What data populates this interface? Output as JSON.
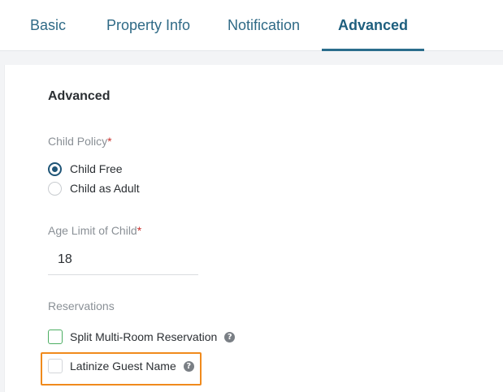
{
  "tabs": [
    {
      "label": "Basic"
    },
    {
      "label": "Property Info"
    },
    {
      "label": "Notification"
    },
    {
      "label": "Advanced",
      "active": true
    }
  ],
  "section": {
    "title": "Advanced"
  },
  "child_policy": {
    "label": "Child Policy",
    "required_mark": "*",
    "options": [
      {
        "label": "Child Free",
        "selected": true
      },
      {
        "label": "Child as Adult",
        "selected": false
      }
    ]
  },
  "age_limit": {
    "label": "Age Limit of Child",
    "required_mark": "*",
    "value": "18"
  },
  "reservations": {
    "label": "Reservations",
    "options": [
      {
        "label": "Split Multi-Room Reservation",
        "checked": false,
        "help": "?"
      },
      {
        "label": "Latinize Guest Name",
        "checked": false,
        "help": "?",
        "highlighted": true
      }
    ]
  },
  "colors": {
    "tab_text": "#2f6a86",
    "active_underline": "#2a6d8c",
    "required": "#c9302c",
    "highlight": "#f08a1c",
    "checkbox_focus": "#4cae62"
  },
  "icons": {
    "help": "question-circle-icon"
  }
}
